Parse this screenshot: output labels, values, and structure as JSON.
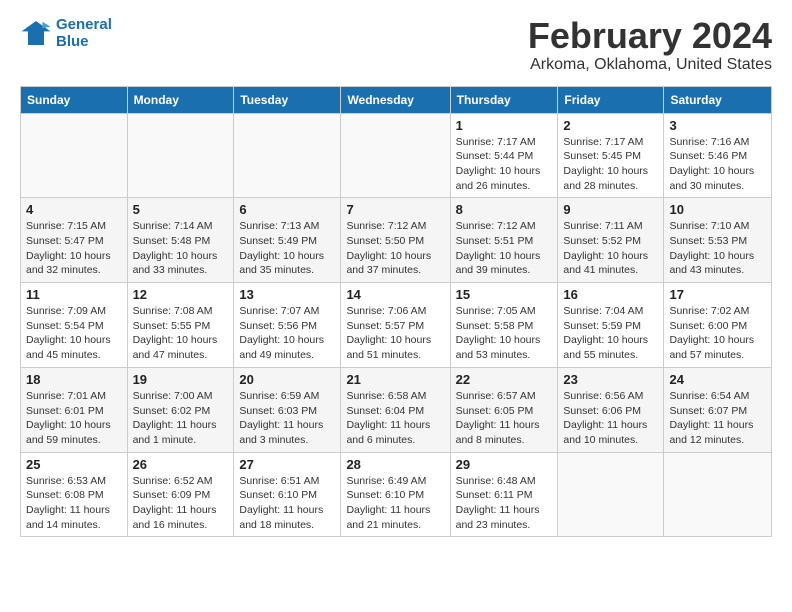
{
  "logo": {
    "line1": "General",
    "line2": "Blue"
  },
  "title": "February 2024",
  "subtitle": "Arkoma, Oklahoma, United States",
  "days_of_week": [
    "Sunday",
    "Monday",
    "Tuesday",
    "Wednesday",
    "Thursday",
    "Friday",
    "Saturday"
  ],
  "weeks": [
    [
      {
        "day": "",
        "detail": ""
      },
      {
        "day": "",
        "detail": ""
      },
      {
        "day": "",
        "detail": ""
      },
      {
        "day": "",
        "detail": ""
      },
      {
        "day": "1",
        "detail": "Sunrise: 7:17 AM\nSunset: 5:44 PM\nDaylight: 10 hours\nand 26 minutes."
      },
      {
        "day": "2",
        "detail": "Sunrise: 7:17 AM\nSunset: 5:45 PM\nDaylight: 10 hours\nand 28 minutes."
      },
      {
        "day": "3",
        "detail": "Sunrise: 7:16 AM\nSunset: 5:46 PM\nDaylight: 10 hours\nand 30 minutes."
      }
    ],
    [
      {
        "day": "4",
        "detail": "Sunrise: 7:15 AM\nSunset: 5:47 PM\nDaylight: 10 hours\nand 32 minutes."
      },
      {
        "day": "5",
        "detail": "Sunrise: 7:14 AM\nSunset: 5:48 PM\nDaylight: 10 hours\nand 33 minutes."
      },
      {
        "day": "6",
        "detail": "Sunrise: 7:13 AM\nSunset: 5:49 PM\nDaylight: 10 hours\nand 35 minutes."
      },
      {
        "day": "7",
        "detail": "Sunrise: 7:12 AM\nSunset: 5:50 PM\nDaylight: 10 hours\nand 37 minutes."
      },
      {
        "day": "8",
        "detail": "Sunrise: 7:12 AM\nSunset: 5:51 PM\nDaylight: 10 hours\nand 39 minutes."
      },
      {
        "day": "9",
        "detail": "Sunrise: 7:11 AM\nSunset: 5:52 PM\nDaylight: 10 hours\nand 41 minutes."
      },
      {
        "day": "10",
        "detail": "Sunrise: 7:10 AM\nSunset: 5:53 PM\nDaylight: 10 hours\nand 43 minutes."
      }
    ],
    [
      {
        "day": "11",
        "detail": "Sunrise: 7:09 AM\nSunset: 5:54 PM\nDaylight: 10 hours\nand 45 minutes."
      },
      {
        "day": "12",
        "detail": "Sunrise: 7:08 AM\nSunset: 5:55 PM\nDaylight: 10 hours\nand 47 minutes."
      },
      {
        "day": "13",
        "detail": "Sunrise: 7:07 AM\nSunset: 5:56 PM\nDaylight: 10 hours\nand 49 minutes."
      },
      {
        "day": "14",
        "detail": "Sunrise: 7:06 AM\nSunset: 5:57 PM\nDaylight: 10 hours\nand 51 minutes."
      },
      {
        "day": "15",
        "detail": "Sunrise: 7:05 AM\nSunset: 5:58 PM\nDaylight: 10 hours\nand 53 minutes."
      },
      {
        "day": "16",
        "detail": "Sunrise: 7:04 AM\nSunset: 5:59 PM\nDaylight: 10 hours\nand 55 minutes."
      },
      {
        "day": "17",
        "detail": "Sunrise: 7:02 AM\nSunset: 6:00 PM\nDaylight: 10 hours\nand 57 minutes."
      }
    ],
    [
      {
        "day": "18",
        "detail": "Sunrise: 7:01 AM\nSunset: 6:01 PM\nDaylight: 10 hours\nand 59 minutes."
      },
      {
        "day": "19",
        "detail": "Sunrise: 7:00 AM\nSunset: 6:02 PM\nDaylight: 11 hours\nand 1 minute."
      },
      {
        "day": "20",
        "detail": "Sunrise: 6:59 AM\nSunset: 6:03 PM\nDaylight: 11 hours\nand 3 minutes."
      },
      {
        "day": "21",
        "detail": "Sunrise: 6:58 AM\nSunset: 6:04 PM\nDaylight: 11 hours\nand 6 minutes."
      },
      {
        "day": "22",
        "detail": "Sunrise: 6:57 AM\nSunset: 6:05 PM\nDaylight: 11 hours\nand 8 minutes."
      },
      {
        "day": "23",
        "detail": "Sunrise: 6:56 AM\nSunset: 6:06 PM\nDaylight: 11 hours\nand 10 minutes."
      },
      {
        "day": "24",
        "detail": "Sunrise: 6:54 AM\nSunset: 6:07 PM\nDaylight: 11 hours\nand 12 minutes."
      }
    ],
    [
      {
        "day": "25",
        "detail": "Sunrise: 6:53 AM\nSunset: 6:08 PM\nDaylight: 11 hours\nand 14 minutes."
      },
      {
        "day": "26",
        "detail": "Sunrise: 6:52 AM\nSunset: 6:09 PM\nDaylight: 11 hours\nand 16 minutes."
      },
      {
        "day": "27",
        "detail": "Sunrise: 6:51 AM\nSunset: 6:10 PM\nDaylight: 11 hours\nand 18 minutes."
      },
      {
        "day": "28",
        "detail": "Sunrise: 6:49 AM\nSunset: 6:10 PM\nDaylight: 11 hours\nand 21 minutes."
      },
      {
        "day": "29",
        "detail": "Sunrise: 6:48 AM\nSunset: 6:11 PM\nDaylight: 11 hours\nand 23 minutes."
      },
      {
        "day": "",
        "detail": ""
      },
      {
        "day": "",
        "detail": ""
      }
    ]
  ]
}
